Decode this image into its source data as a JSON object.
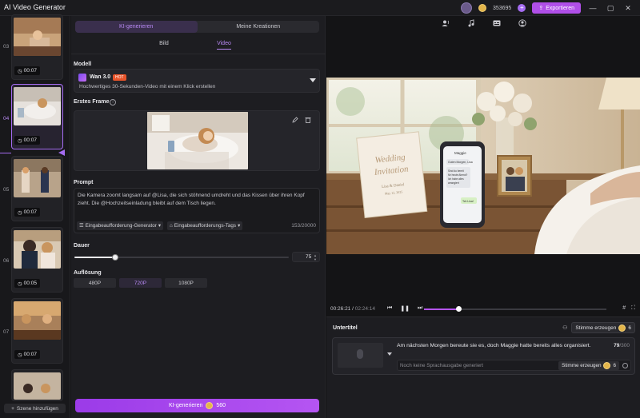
{
  "app": {
    "title": "AI Video Generator",
    "credits": "353695",
    "export_label": "Exportieren"
  },
  "scenes": {
    "items": [
      {
        "number": "03",
        "duration": "00:07"
      },
      {
        "number": "04",
        "duration": "00:07"
      },
      {
        "number": "05",
        "duration": "00:07"
      },
      {
        "number": "06",
        "duration": "00:05"
      },
      {
        "number": "07",
        "duration": "00:07"
      }
    ],
    "add_label": "Szene hinzufügen"
  },
  "panel": {
    "tabs": [
      "KI-generieren",
      "Meine Kreationen"
    ],
    "sub_tabs": [
      "Bild",
      "Video"
    ],
    "model_label": "Modell",
    "model_name": "Wan 3.0",
    "model_badge": "HOT",
    "model_desc": "Hochwertiges 30-Sekunden-Video mit einem Klick erstellen",
    "first_frame_label": "Erstes Frame",
    "prompt_label": "Prompt",
    "prompt_text": "Die Kamera zoomt langsam auf @Lisa, die sich stöhnend umdreht und das Kissen über ihren Kopf zieht. Die @Hochzeitseinladung bleibt auf dem Tisch liegen.",
    "prompt_tool_1": "Eingabeaufforderung-Generator",
    "prompt_tool_2": "Eingabeaufforderungs-Tags",
    "prompt_count": "153/20000",
    "duration_label": "Dauer",
    "duration_value": "75",
    "duration_fraction": 0.19,
    "resolution_label": "Auflösung",
    "resolutions": [
      "480P",
      "720P",
      "1080P"
    ],
    "generate_label": "KI-generieren",
    "generate_cost": "560"
  },
  "player": {
    "current_time": "00:26:21",
    "total_time": "02:24:14",
    "progress": 0.19
  },
  "subtitles": {
    "title": "Untertitel",
    "voice_button": "Stimme erzeugen",
    "voice_cost": "6",
    "item_text": "Am nächsten Morgen bereute sie es, doch Maggie hatte bereits alles organisiert.",
    "item_count": "79",
    "item_max": "/300",
    "audio_placeholder": "Noch keine Sprachausgabe generiert",
    "item_voice_button": "Stimme erzeugen",
    "item_voice_cost": "6"
  },
  "colors": {
    "accent": "#b555f2",
    "accent_text": "#b98af5",
    "hot_badge": "#e8542a"
  }
}
